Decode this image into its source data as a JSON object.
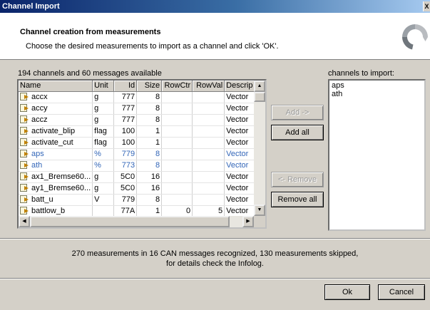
{
  "window": {
    "title": "Channel Import",
    "close_glyph": "X"
  },
  "header": {
    "title": "Channel creation from measurements",
    "subtitle": "Choose the desired measurements to import as a channel and click 'OK'.",
    "logo_icon": "circular-arrows-icon"
  },
  "available": {
    "label": "194 channels and 60 messages available",
    "columns": [
      "Name",
      "Unit",
      "Id",
      "Size",
      "RowCtr",
      "RowVal",
      "Descrip"
    ],
    "rows": [
      {
        "name": "accx",
        "unit": "g",
        "id": "777",
        "size": "8",
        "rowctr": "",
        "rowval": "",
        "desc": "Vector"
      },
      {
        "name": "accy",
        "unit": "g",
        "id": "777",
        "size": "8",
        "rowctr": "",
        "rowval": "",
        "desc": "Vector"
      },
      {
        "name": "accz",
        "unit": "g",
        "id": "777",
        "size": "8",
        "rowctr": "",
        "rowval": "",
        "desc": "Vector"
      },
      {
        "name": "activate_blip",
        "unit": "flag",
        "id": "100",
        "size": "1",
        "rowctr": "",
        "rowval": "",
        "desc": "Vector"
      },
      {
        "name": "activate_cut",
        "unit": "flag",
        "id": "100",
        "size": "1",
        "rowctr": "",
        "rowval": "",
        "desc": "Vector"
      },
      {
        "name": "aps",
        "unit": "%",
        "id": "779",
        "size": "8",
        "rowctr": "",
        "rowval": "",
        "desc": "Vector"
      },
      {
        "name": "ath",
        "unit": "%",
        "id": "773",
        "size": "8",
        "rowctr": "",
        "rowval": "",
        "desc": "Vector"
      },
      {
        "name": "ax1_Bremse60...",
        "unit": "g",
        "id": "5C0",
        "size": "16",
        "rowctr": "",
        "rowval": "",
        "desc": "Vector"
      },
      {
        "name": "ay1_Bremse60...",
        "unit": "g",
        "id": "5C0",
        "size": "16",
        "rowctr": "",
        "rowval": "",
        "desc": "Vector"
      },
      {
        "name": "batt_u",
        "unit": "V",
        "id": "779",
        "size": "8",
        "rowctr": "",
        "rowval": "",
        "desc": "Vector"
      },
      {
        "name": "battlow_b",
        "unit": "",
        "id": "77A",
        "size": "1",
        "rowctr": "0",
        "rowval": "5",
        "desc": "Vector"
      }
    ]
  },
  "buttons": {
    "add": "Add ->",
    "add_all": "Add all",
    "remove": "<- Remove",
    "remove_all": "Remove all",
    "ok": "Ok",
    "cancel": "Cancel"
  },
  "import": {
    "label": "channels to import:",
    "items": [
      "aps",
      "ath"
    ]
  },
  "status": {
    "line1": "270 measurements in 16 CAN messages recognized, 130 measurements skipped,",
    "line2": "for details check the Infolog."
  },
  "colors": {
    "selected_row_text": "#3366b8",
    "titlebar": "#0a246a"
  }
}
